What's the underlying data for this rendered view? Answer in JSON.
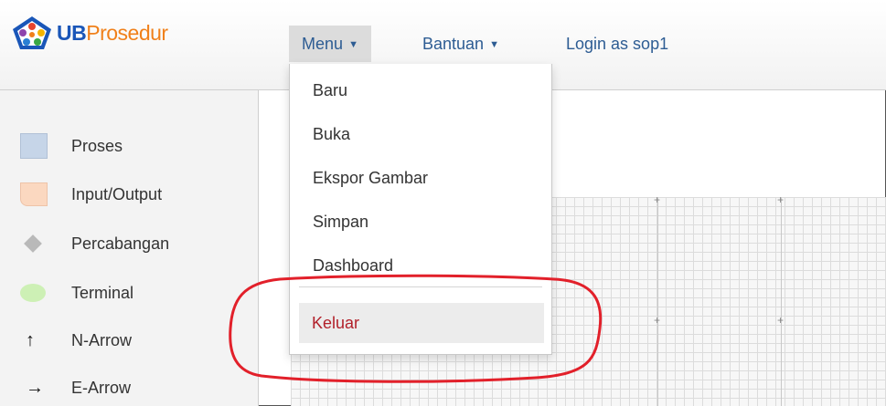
{
  "app": {
    "logo_ub": "UB",
    "logo_rest": "Prosedur"
  },
  "nav": {
    "menu_label": "Menu",
    "bantuan_label": "Bantuan",
    "login_label": "Login as sop1"
  },
  "sidebar": {
    "items": [
      {
        "label": "Proses",
        "icon": "rectangle-icon"
      },
      {
        "label": "Input/Output",
        "icon": "document-shape-icon"
      },
      {
        "label": "Percabangan",
        "icon": "diamond-icon"
      },
      {
        "label": "Terminal",
        "icon": "ellipse-icon"
      },
      {
        "label": "N-Arrow",
        "icon": "arrow-up-icon"
      },
      {
        "label": "E-Arrow",
        "icon": "arrow-right-icon"
      }
    ]
  },
  "dropdown": {
    "items": [
      "Baru",
      "Buka",
      "Ekspor Gambar",
      "Simpan",
      "Dashboard"
    ],
    "logout": "Keluar"
  },
  "colors": {
    "nav_link": "#2d5c93",
    "logout_text": "#b2202a",
    "annotation": "#e2202a"
  }
}
